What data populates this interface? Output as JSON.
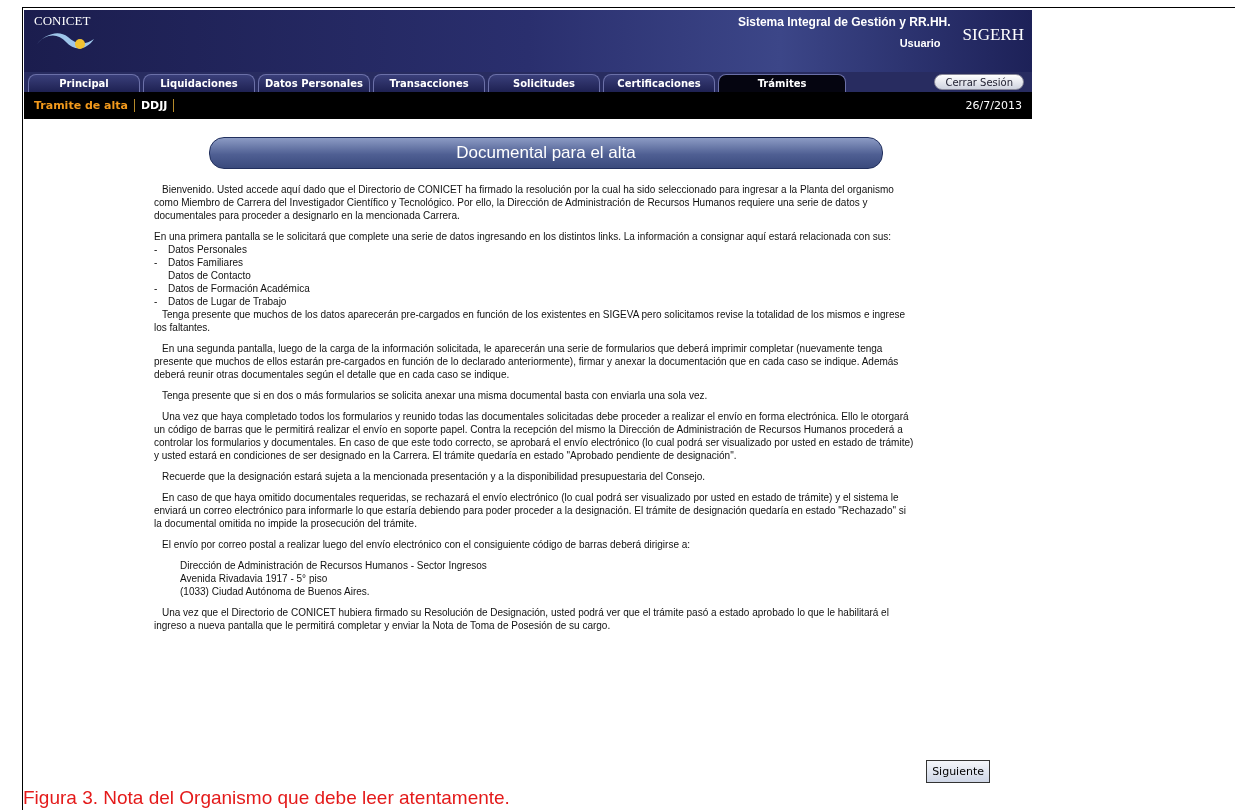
{
  "header": {
    "org": "CONICET",
    "system": "Sistema Integral de Gestión y RR.HH.",
    "user": "Usuario",
    "logo": "SIGERH"
  },
  "tabs": [
    {
      "label": "Principal",
      "selected": false
    },
    {
      "label": "Liquidaciones",
      "selected": false
    },
    {
      "label": "Datos Personales",
      "selected": false
    },
    {
      "label": "Transacciones",
      "selected": false
    },
    {
      "label": "Solicitudes",
      "selected": false
    },
    {
      "label": "Certificaciones",
      "selected": false
    },
    {
      "label": "Trámites",
      "selected": true
    }
  ],
  "logout": "Cerrar Sesión",
  "subnav": [
    {
      "label": "Tramite de alta",
      "selected": true
    },
    {
      "label": "DDJJ",
      "selected": false
    }
  ],
  "date": "26/7/2013",
  "title": "Documental para el alta",
  "blocks": [
    {
      "kind": "para",
      "text": "Bienvenido. Usted accede aquí dado que el Directorio de CONICET ha firmado la resolución por la cual ha sido seleccionado para ingresar a la Planta del organismo como Miembro de Carrera del Investigador Científico y Tecnológico. Por ello, la Dirección de Administración de Recursos Humanos requiere una serie de datos y documentales para proceder a designarlo en la mencionada Carrera."
    },
    {
      "kind": "plain",
      "text": "En una primera pantalla se le solicitará que complete una serie de datos ingresando en los distintos links. La información a consignar aquí estará relacionada con sus:"
    },
    {
      "kind": "item",
      "marker": "-",
      "text": "Datos Personales"
    },
    {
      "kind": "item",
      "marker": "-",
      "text": "Datos Familiares"
    },
    {
      "kind": "item",
      "text": "Datos de Contacto"
    },
    {
      "kind": "item",
      "marker": "-",
      "text": "Datos de Formación Académica"
    },
    {
      "kind": "item",
      "marker": "-",
      "text": "Datos de Lugar de Trabajo"
    },
    {
      "kind": "para",
      "text": "Tenga presente que muchos de los datos aparecerán pre-cargados en función de los existentes en SIGEVA pero solicitamos revise la totalidad de los mismos e ingrese los faltantes."
    },
    {
      "kind": "para",
      "text": "En una segunda pantalla, luego de la carga de la información solicitada, le aparecerán una serie de formularios que deberá imprimir completar (nuevamente tenga presente que muchos de ellos estarán pre-cargados en función de lo declarado anteriormente), firmar y anexar la documentación que en cada caso se indique. Además deberá reunir otras documentales según el detalle que en cada caso se indique."
    },
    {
      "kind": "para",
      "text": "Tenga presente que si en dos o más formularios se solicita anexar una misma documental basta con enviarla una sola vez."
    },
    {
      "kind": "para",
      "text": "Una vez que haya completado todos los formularios y reunido todas las documentales solicitadas debe proceder a realizar el envío en forma electrónica. Ello le otorgará un código de barras que le permitirá realizar el envío en soporte papel. Contra la recepción del mismo la Dirección de Administración de Recursos Humanos procederá a controlar los formularios y documentales. En caso de que este todo correcto, se aprobará el envío electrónico (lo cual podrá ser visualizado por usted en estado de trámite) y usted estará en condiciones de ser designado en la Carrera. El trámite quedaría en estado \"Aprobado pendiente de designación\"."
    },
    {
      "kind": "para",
      "text": "Recuerde que la designación estará sujeta a la mencionada presentación y a la disponibilidad presupuestaria del Consejo."
    },
    {
      "kind": "para",
      "text": "En caso de que haya omitido documentales requeridas, se rechazará el envío electrónico (lo cual podrá ser visualizado por usted en estado de trámite) y el sistema le enviará un correo electrónico para informarle lo que estaría debiendo para poder proceder a la designación. El trámite de designación quedaría en estado \"Rechazado\" si la documental omitida no impide la prosecución del trámite."
    },
    {
      "kind": "para",
      "text": "El envío por correo postal a realizar luego del envío electrónico con el consiguiente código de barras deberá dirigirse a:"
    },
    {
      "kind": "address",
      "lines": [
        "Dirección de Administración de Recursos Humanos - Sector Ingresos",
        "Avenida Rivadavia 1917 - 5° piso",
        "(1033)   Ciudad Autónoma de Buenos Aires."
      ]
    },
    {
      "kind": "para",
      "text": "Una vez que el Directorio de CONICET hubiera firmado su Resolución de Designación, usted podrá ver que el trámite pasó a estado aprobado lo que le habilitará el ingreso a nueva pantalla que le permitirá completar y enviar la Nota de Toma de Posesión de su cargo."
    }
  ],
  "next": "Siguiente",
  "caption": "Figura 3. Nota del Organismo que debe leer atentamente."
}
